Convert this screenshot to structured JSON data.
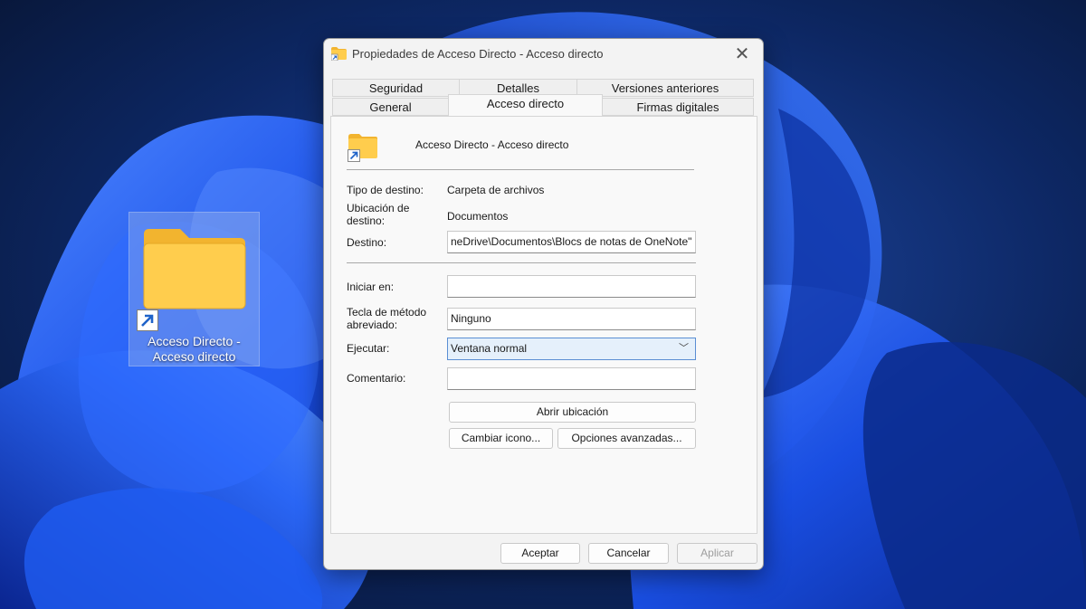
{
  "desktop": {
    "icon_label": "Acceso Directo -\nAcceso directo"
  },
  "dialog": {
    "title": "Propiedades de Acceso Directo - Acceso directo",
    "tabs_row1": [
      "Seguridad",
      "Detalles",
      "Versiones anteriores"
    ],
    "tabs_row2": [
      "General",
      "Acceso directo",
      "Firmas digitales"
    ],
    "active_tab": "Acceso directo",
    "shortcut_name": "Acceso Directo - Acceso directo",
    "labels": {
      "target_type": "Tipo de destino:",
      "target_location": "Ubicación de\ndestino:",
      "target": "Destino:",
      "start_in": "Iniciar en:",
      "shortcut_key": "Tecla de método\nabreviado:",
      "run": "Ejecutar:",
      "comment": "Comentario:"
    },
    "values": {
      "target_type": "Carpeta de archivos",
      "target_location": "Documentos",
      "target": "neDrive\\Documentos\\Blocs de notas de OneNote\"",
      "start_in": "",
      "shortcut_key": "Ninguno",
      "run": "Ventana normal",
      "comment": ""
    },
    "buttons": {
      "open_location": "Abrir ubicación",
      "change_icon": "Cambiar icono...",
      "advanced": "Opciones avanzadas...",
      "ok": "Aceptar",
      "cancel": "Cancelar",
      "apply": "Aplicar"
    },
    "icons": [
      "folder-icon",
      "shortcut-arrow-icon",
      "close-icon",
      "chevron-down-icon"
    ]
  }
}
